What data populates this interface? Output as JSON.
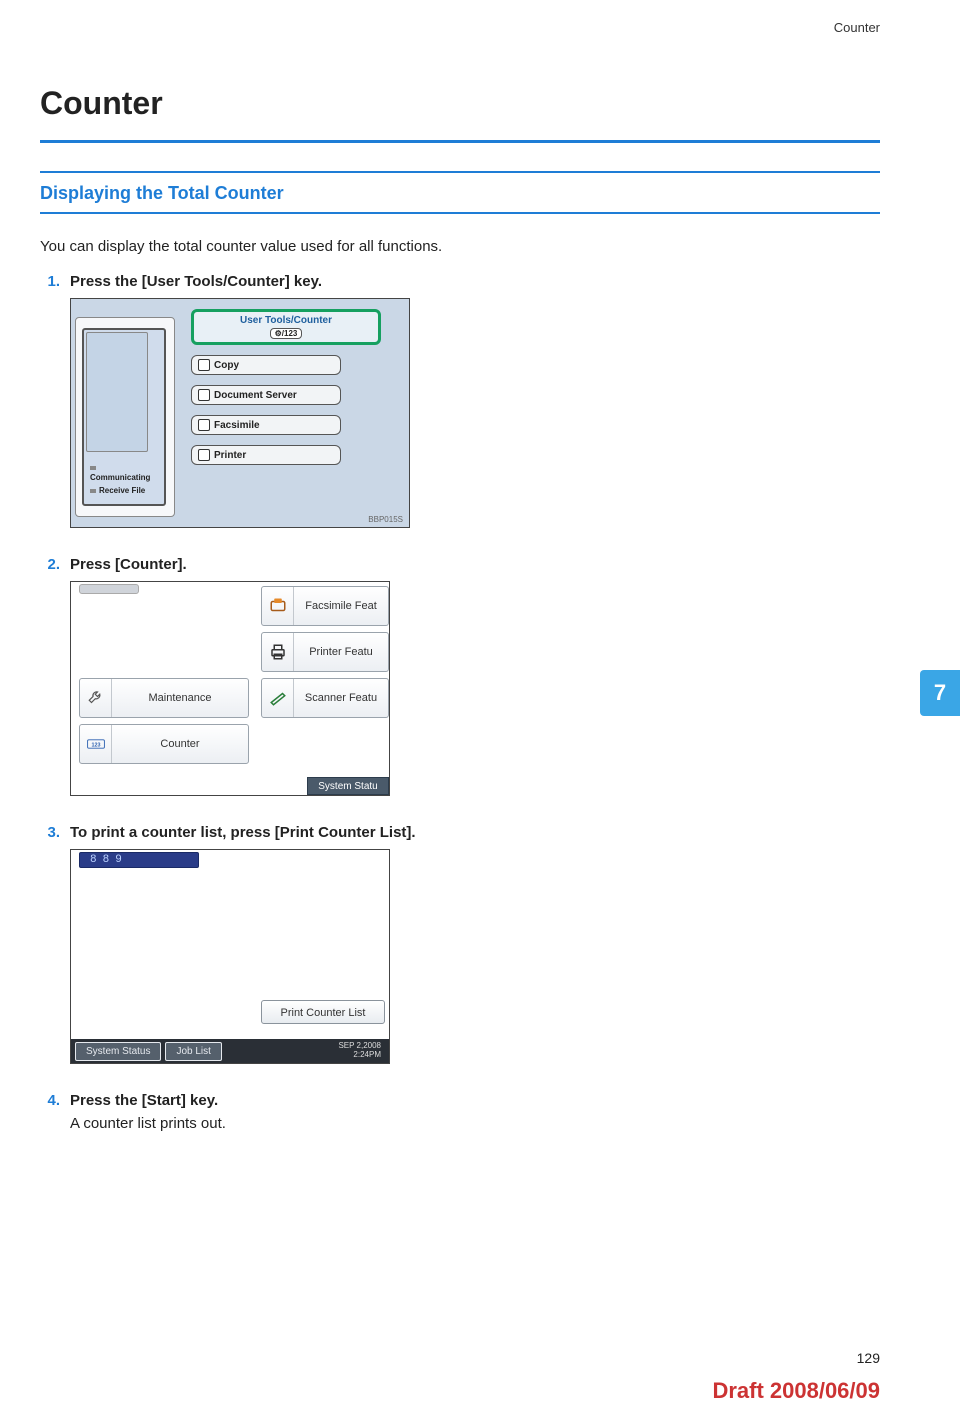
{
  "header": {
    "running": "Counter"
  },
  "title": "Counter",
  "section": "Displaying the Total Counter",
  "intro": "You can display the total counter value used for all functions.",
  "steps": [
    {
      "num": "1.",
      "text": "Press the [User Tools/Counter] key."
    },
    {
      "num": "2.",
      "text": "Press [Counter]."
    },
    {
      "num": "3.",
      "text": "To print a counter list, press [Print Counter List]."
    },
    {
      "num": "4.",
      "text": "Press the [Start] key.",
      "sub": "A counter list prints out."
    }
  ],
  "fig1": {
    "highlight_label": "User Tools/Counter",
    "highlight_chip": "⚙/123",
    "buttons": [
      "Copy",
      "Document Server",
      "Facsimile",
      "Printer"
    ],
    "status1": "Communicating",
    "status2": "Receive File",
    "ref": "BBP015S"
  },
  "fig2": {
    "tiles_right": [
      "Facsimile Feat",
      "Printer Featu",
      "Scanner Featu"
    ],
    "tiles_left": [
      "Maintenance",
      "Counter"
    ],
    "sysbar": "System Statu"
  },
  "fig3": {
    "segment": "889",
    "print_btn": "Print Counter List",
    "tabs": [
      "System Status",
      "Job List"
    ],
    "clock_date": "SEP   2,2008",
    "clock_time": "2:24PM"
  },
  "side_tab": "7",
  "page_number": "129",
  "draft": "Draft 2008/06/09"
}
